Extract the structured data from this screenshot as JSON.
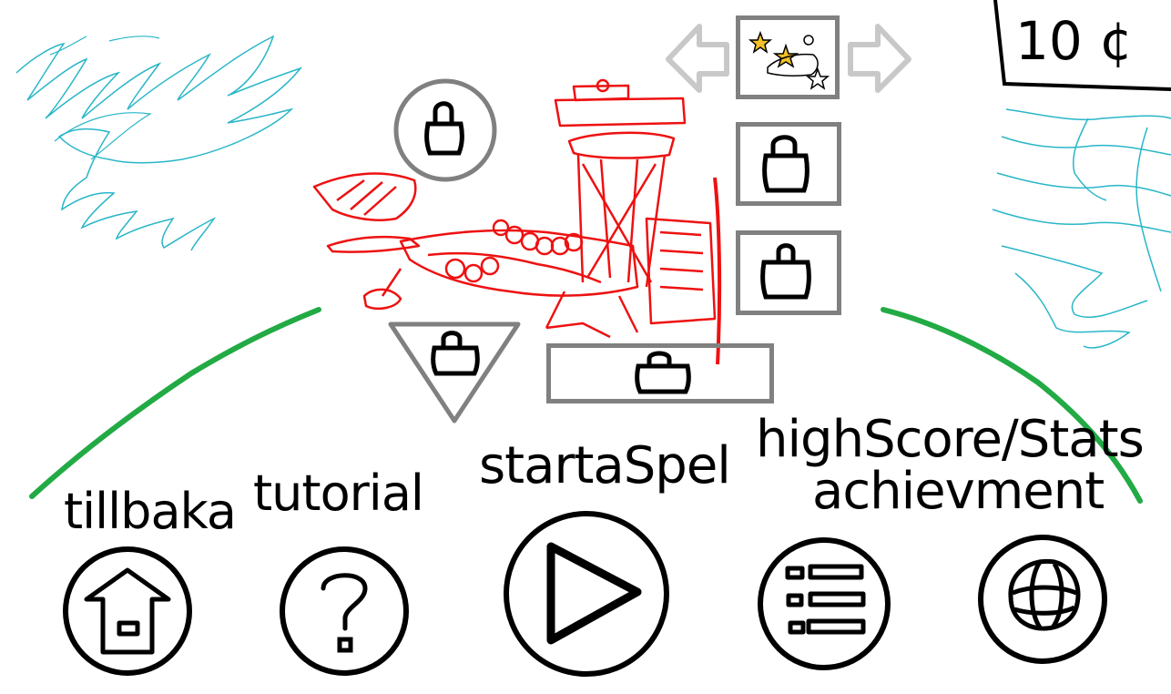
{
  "currency": {
    "amount": "10 ¢"
  },
  "nav": {
    "prev_label": "",
    "next_label": ""
  },
  "buttons": {
    "back_label": "tillbaka",
    "tutorial_label": "tutorial",
    "start_label": "startaSpel",
    "highscore_label_line1": "highScore/Stats",
    "highscore_label_line2": "achievment"
  },
  "icons": {
    "back": "home-arrow-icon",
    "tutorial": "question-mark-icon",
    "start": "play-triangle-icon",
    "highscore": "list-icon",
    "achievement": "globe-icon",
    "locked": "padlock-icon",
    "level": "stars-level-icon"
  },
  "colors": {
    "scribble_blue": "#29b6c8",
    "hill_green": "#22aa44",
    "ship_red": "#ee1111",
    "slot_gray": "#808080",
    "arrow_gray": "#c8c8c8"
  }
}
